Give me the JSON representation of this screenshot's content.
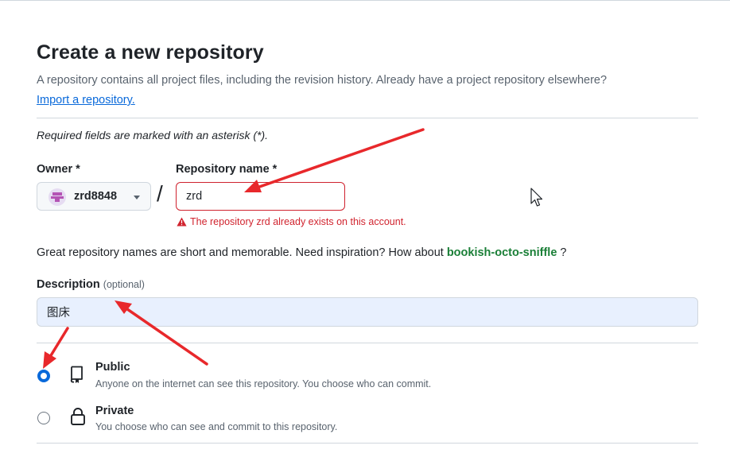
{
  "page": {
    "title": "Create a new repository",
    "subtitle": "A repository contains all project files, including the revision history. Already have a project repository elsewhere?",
    "import_link": "Import a repository.",
    "required_note": "Required fields are marked with an asterisk (*)."
  },
  "form": {
    "owner": {
      "label": "Owner *",
      "value": "zrd8848",
      "avatar": "identicon-avatar"
    },
    "separator": "/",
    "repository_name": {
      "label": "Repository name *",
      "value": "zrd",
      "error": "The repository zrd already exists on this account.",
      "error_icon": "alert-triangle-icon",
      "error_color": "#d1242f"
    },
    "inspiration": {
      "text": "Great repository names are short and memorable. Need inspiration? How about",
      "suggestion": "bookish-octo-sniffle",
      "suffix": "?"
    },
    "description": {
      "label": "Description",
      "optional": "(optional)",
      "value": "图床"
    },
    "visibility": [
      {
        "title": "Public",
        "description": "Anyone on the internet can see this repository. You choose who can commit.",
        "icon": "repo-icon",
        "selected": true
      },
      {
        "title": "Private",
        "description": "You choose who can see and commit to this repository.",
        "icon": "lock-icon",
        "selected": false
      }
    ]
  },
  "colors": {
    "link": "#0969da",
    "error": "#d1242f",
    "suggestion": "#1a7f37",
    "annotation_arrow": "#e8282b",
    "description_fill": "#e8f0fe"
  }
}
